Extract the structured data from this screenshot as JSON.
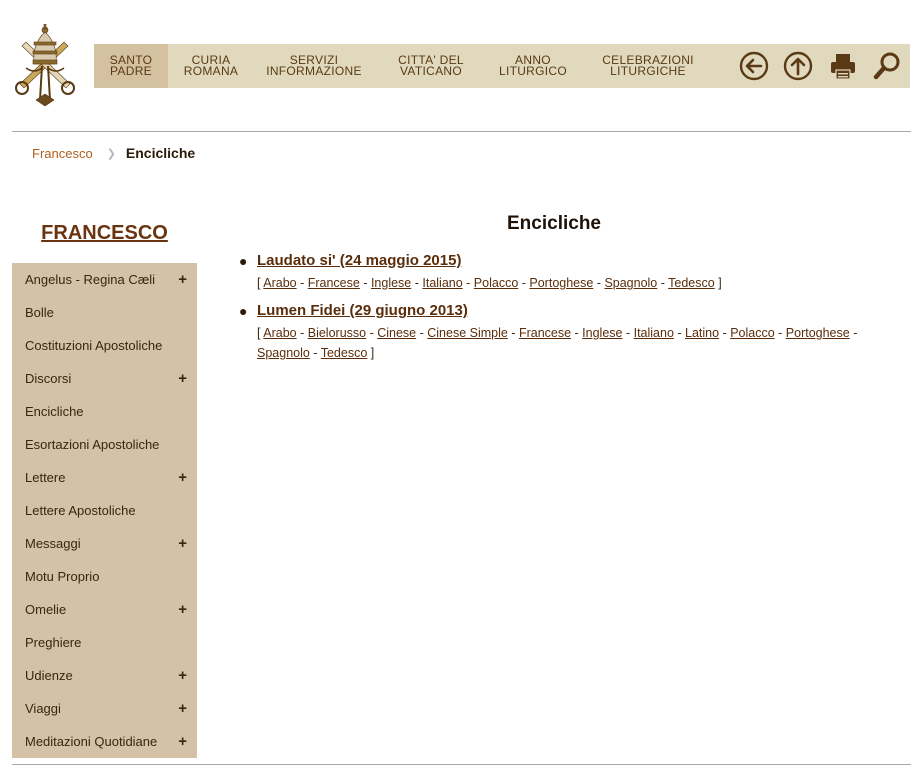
{
  "topnav": {
    "items": [
      {
        "label": "SANTO\nPADRE",
        "active": true
      },
      {
        "label": "CURIA\nROMANA"
      },
      {
        "label": "SERVIZI\nINFORMAZIONE"
      },
      {
        "label": "CITTA' DEL\nVATICANO"
      },
      {
        "label": "ANNO\nLITURGICO"
      },
      {
        "label": "CELEBRAZIONI\nLITURGICHE"
      }
    ],
    "tools": [
      "back-arrow-icon",
      "up-arrow-icon",
      "print-icon",
      "search-icon"
    ]
  },
  "breadcrumb": {
    "parent": "Francesco",
    "current": "Encicliche"
  },
  "sidebar": {
    "title": "FRANCESCO",
    "items": [
      {
        "label": "Angelus - Regina Cæli",
        "expandable": "+"
      },
      {
        "label": "Bolle",
        "expandable": ""
      },
      {
        "label": "Costituzioni Apostoliche",
        "expandable": ""
      },
      {
        "label": "Discorsi",
        "expandable": "+"
      },
      {
        "label": "Encicliche",
        "expandable": ""
      },
      {
        "label": "Esortazioni Apostoliche",
        "expandable": ""
      },
      {
        "label": "Lettere",
        "expandable": "+"
      },
      {
        "label": "Lettere Apostoliche",
        "expandable": ""
      },
      {
        "label": "Messaggi",
        "expandable": "+"
      },
      {
        "label": "Motu Proprio",
        "expandable": ""
      },
      {
        "label": "Omelie",
        "expandable": "+"
      },
      {
        "label": "Preghiere",
        "expandable": ""
      },
      {
        "label": "Udienze",
        "expandable": "+"
      },
      {
        "label": "Viaggi",
        "expandable": "+"
      },
      {
        "label": "Meditazioni Quotidiane",
        "expandable": "+"
      }
    ]
  },
  "main": {
    "title": "Encicliche",
    "encyclicals": [
      {
        "title": "Laudato si' (24 maggio 2015)",
        "languages": [
          "Arabo",
          "Francese",
          "Inglese",
          "Italiano",
          "Polacco",
          "Portoghese",
          "Spagnolo",
          "Tedesco"
        ]
      },
      {
        "title": "Lumen Fidei (29 giugno 2013)",
        "languages": [
          "Arabo",
          "Bielorusso",
          "Cinese",
          "Cinese Simple",
          "Francese",
          "Inglese",
          "Italiano",
          "Latino",
          "Polacco",
          "Portoghese",
          "Spagnolo",
          "Tedesco"
        ]
      }
    ]
  },
  "colors": {
    "accent": "#5a2e0c",
    "nav_bg": "#e0d9be",
    "sidebar_bg": "#d4c1a6",
    "link_orange": "#b0601e"
  }
}
